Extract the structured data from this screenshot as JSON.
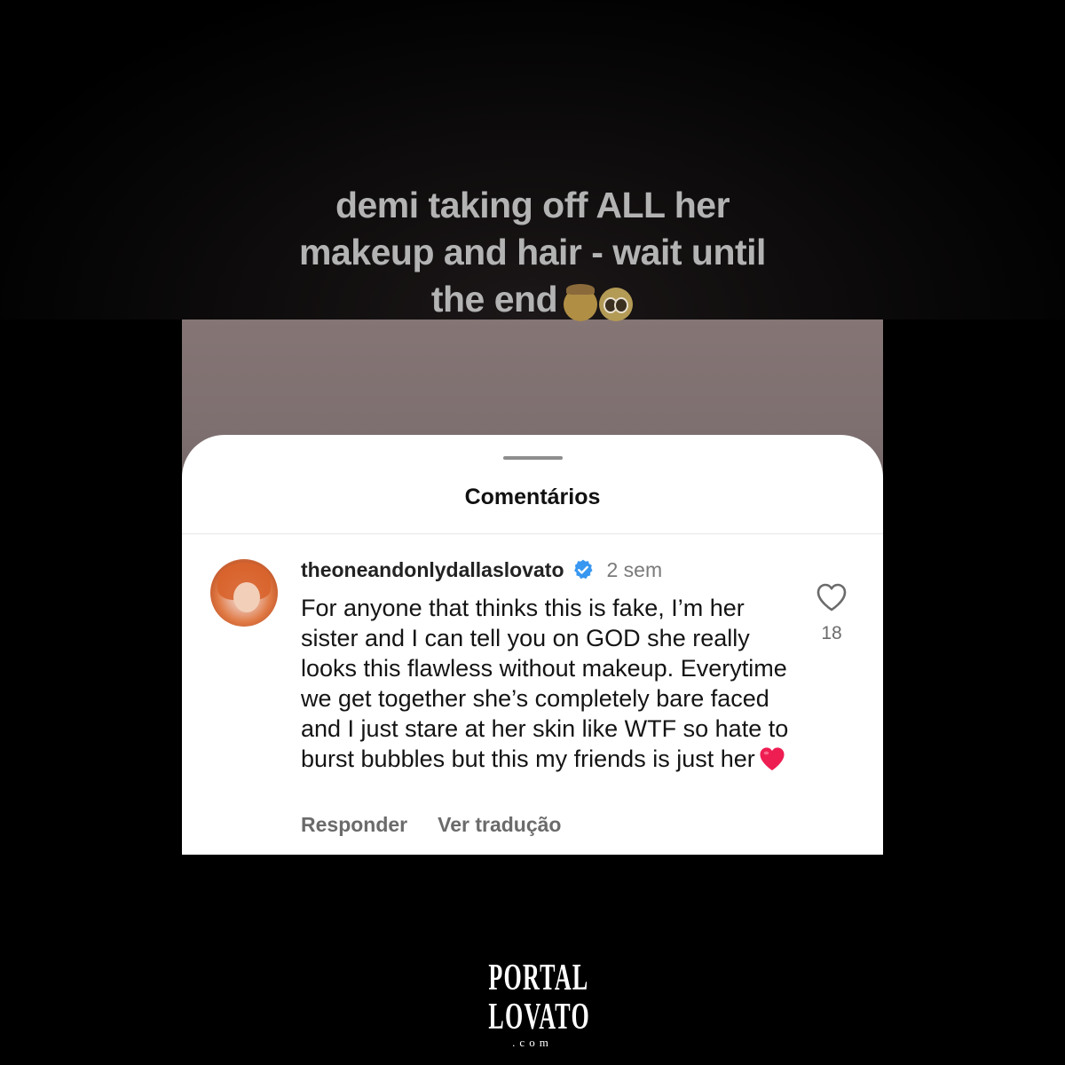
{
  "video": {
    "caption": "demi taking off ALL her makeup and hair - wait until the end",
    "caption_line1": "demi taking off ALL her",
    "caption_line2": "makeup and hair - wait until",
    "caption_line3": "the end",
    "caption_emojis": [
      "exploding-head-emoji",
      "pleading-face-emoji"
    ]
  },
  "comments_sheet": {
    "title": "Comentários",
    "comment": {
      "username": "theoneandonlydallaslovato",
      "verified": true,
      "time": "2 sem",
      "text": "For anyone that thinks this is fake, I’m her sister and I can tell you on GOD she really looks this flawless without makeup. Everytime we get together she’s completely bare faced and I just stare at her skin like WTF so hate to burst bubbles but this my friends is just her",
      "text_emoji": "red-heart-emoji",
      "likes": "18",
      "reply_label": "Responder",
      "translate_label": "Ver tradução"
    }
  },
  "logo": {
    "line1": "PORTAL",
    "line2": "LOVATO",
    "line3": ".com"
  },
  "colors": {
    "background": "#000000",
    "sheet": "#ffffff",
    "verified": "#3897f0",
    "heart": "#ee1d52"
  }
}
